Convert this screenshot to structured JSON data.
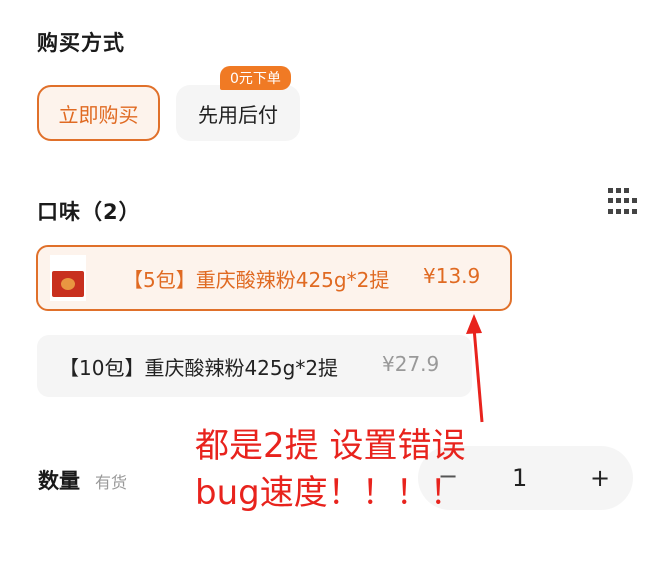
{
  "purchase": {
    "title": "购买方式",
    "buy_now": "立即购买",
    "pay_later": "先用后付",
    "badge": "0元下单"
  },
  "flavor": {
    "title": "口味（2）",
    "options": [
      {
        "label": "【5包】重庆酸辣粉425g*2提",
        "price": "¥13.9",
        "selected": true
      },
      {
        "label": "【10包】重庆酸辣粉425g*2提",
        "price": "¥27.9",
        "selected": false
      }
    ]
  },
  "quantity": {
    "label": "数量",
    "stock": "有货",
    "minus": "−",
    "value": "1",
    "plus": "+"
  },
  "annotation": {
    "line1": "都是2提 设置错误",
    "line2": "bug速度！！！！"
  },
  "colors": {
    "accent": "#e0702a",
    "annotation": "#e8231d"
  },
  "icons": [
    "grid-icon",
    "product-thumbnail"
  ]
}
